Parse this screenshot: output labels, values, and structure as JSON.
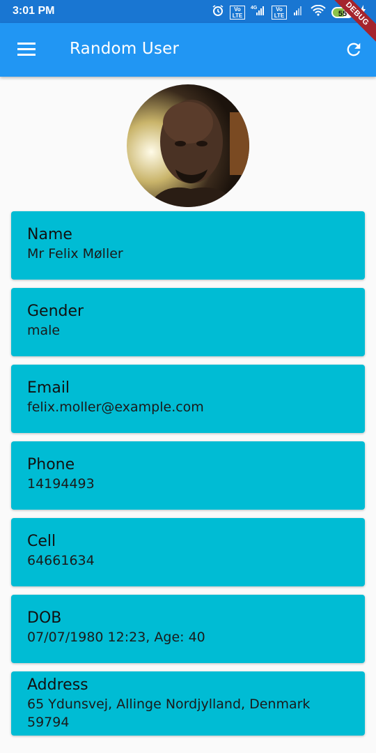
{
  "status_bar": {
    "time": "3:01 PM",
    "battery_level": "55",
    "network_label": "4G",
    "volte_label": "Vo LTE"
  },
  "app_bar": {
    "title": "Random User",
    "menu_icon": "menu-icon",
    "refresh_icon": "refresh-icon",
    "debug_banner": "DEBUG"
  },
  "colors": {
    "status_bar": "#1976D2",
    "app_bar": "#2196F3",
    "card": "#00BCD4",
    "background": "#FAFAFA"
  },
  "fields": [
    {
      "label": "Name",
      "value": "Mr Felix Møller"
    },
    {
      "label": "Gender",
      "value": "male"
    },
    {
      "label": "Email",
      "value": "felix.moller@example.com"
    },
    {
      "label": "Phone",
      "value": "14194493"
    },
    {
      "label": "Cell",
      "value": "64661634"
    },
    {
      "label": "DOB",
      "value": "07/07/1980 12:23, Age: 40"
    },
    {
      "label": "Address",
      "value": "65 Ydunsvej, Allinge Nordjylland, Denmark 59794"
    }
  ]
}
